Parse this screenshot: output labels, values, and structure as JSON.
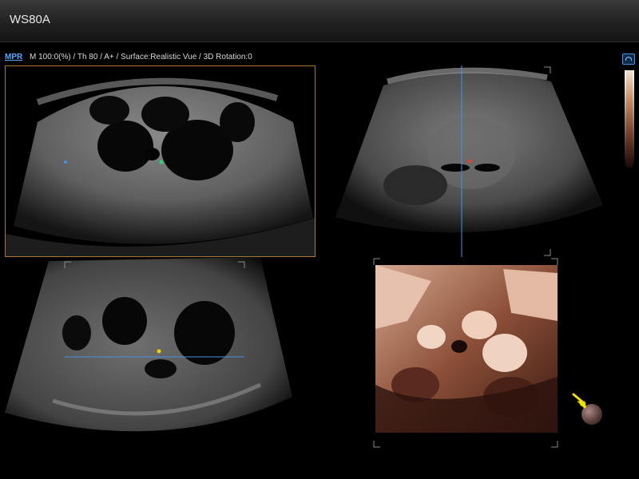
{
  "app": {
    "title": "WS80A"
  },
  "status": {
    "mode_link": "MPR",
    "text": "M 100:0(%) / Th 80 / A+ / Surface:Realistic Vue / 3D Rotation:0"
  },
  "icons": {
    "view_icon": "view-icon",
    "orientation_ball": "orientation-ball-icon",
    "pointer_arrow": "arrow-icon"
  },
  "colors": {
    "mpr_link": "#5aa7ff",
    "quad1_frame": "#a8743f",
    "crosshair": "#4a90e2",
    "render_tone": "#8b4f38",
    "arrow": "#f0e000"
  }
}
